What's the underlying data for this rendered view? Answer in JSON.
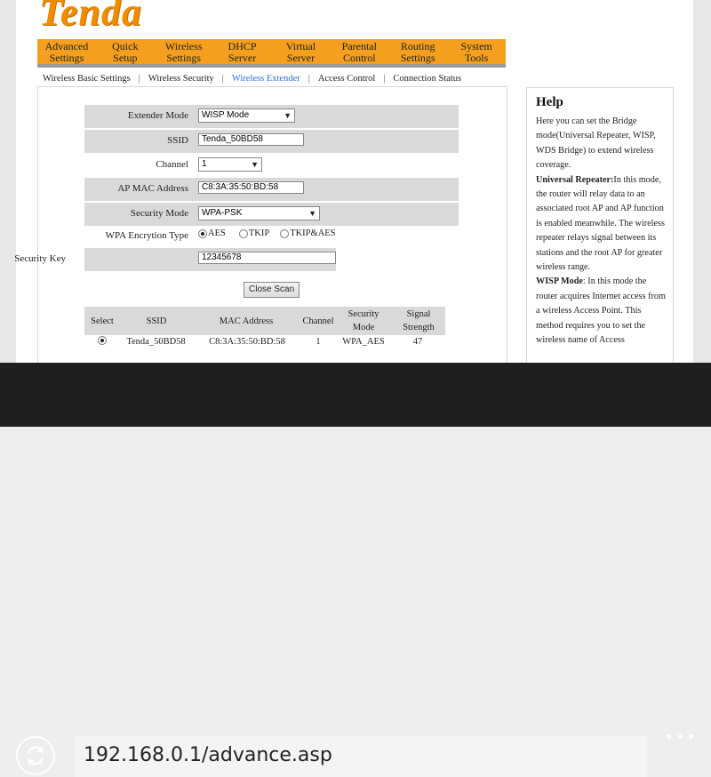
{
  "brand": {
    "logo_text": "Tenda"
  },
  "nav": {
    "items": [
      {
        "label": "Advanced\nSettings"
      },
      {
        "label": "Quick\nSetup"
      },
      {
        "label": "Wireless\nSettings"
      },
      {
        "label": "DHCP\nServer"
      },
      {
        "label": "Virtual\nServer"
      },
      {
        "label": "Parental\nControl"
      },
      {
        "label": "Routing\nSettings"
      },
      {
        "label": "System\nTools"
      }
    ],
    "active_index": 2
  },
  "subnav": {
    "items": [
      "Wireless Basic Settings",
      "Wireless Security",
      "Wireless Extender",
      "Access Control",
      "Connection Status"
    ],
    "active_index": 2
  },
  "form": {
    "extender_mode": {
      "label": "Extender Mode",
      "value": "WISP Mode"
    },
    "ssid": {
      "label": "SSID",
      "value": "Tenda_50BD58"
    },
    "channel": {
      "label": "Channel",
      "value": "1"
    },
    "ap_mac": {
      "label": "AP MAC Address",
      "value": "C8:3A:35:50:BD:58"
    },
    "security_mode": {
      "label": "Security Mode",
      "value": "WPA-PSK"
    },
    "encryption": {
      "label": "WPA Encrytion Type",
      "options": [
        "AES",
        "TKIP",
        "TKIP&AES"
      ],
      "selected": "AES"
    },
    "security_key": {
      "label": "Security Key",
      "value": "12345678"
    },
    "close_scan_button": "Close Scan"
  },
  "scan_table": {
    "headers": [
      "Select",
      "SSID",
      "MAC Address",
      "Channel",
      "Security\nMode",
      "Signal\nStrength"
    ],
    "rows": [
      {
        "ssid": "Tenda_50BD58",
        "mac": "C8:3A:35:50:BD:58",
        "channel": "1",
        "security": "WPA_AES",
        "signal": "47"
      }
    ]
  },
  "help": {
    "title": "Help",
    "intro": "Here you can set the Bridge mode(Universal Repeater, WISP,   WDS Bridge) to extend wireless coverage.",
    "repeater_title": "Universal Repeater:",
    "repeater_text": "In this mode, the router will relay data to an associated root AP and AP function is enabled meanwhile. The wireless repeater relays signal between its stations and the root AP for greater wireless range.",
    "wisp_title": "WISP Mode",
    "wisp_text": ": In this mode the router acquires Internet access from a wireless Access Point. This method requires you to set the wireless name of Access"
  },
  "browser": {
    "url": "192.168.0.1/advance.asp",
    "refresh_icon": "refresh-icon",
    "more_icon": "more-icon"
  }
}
